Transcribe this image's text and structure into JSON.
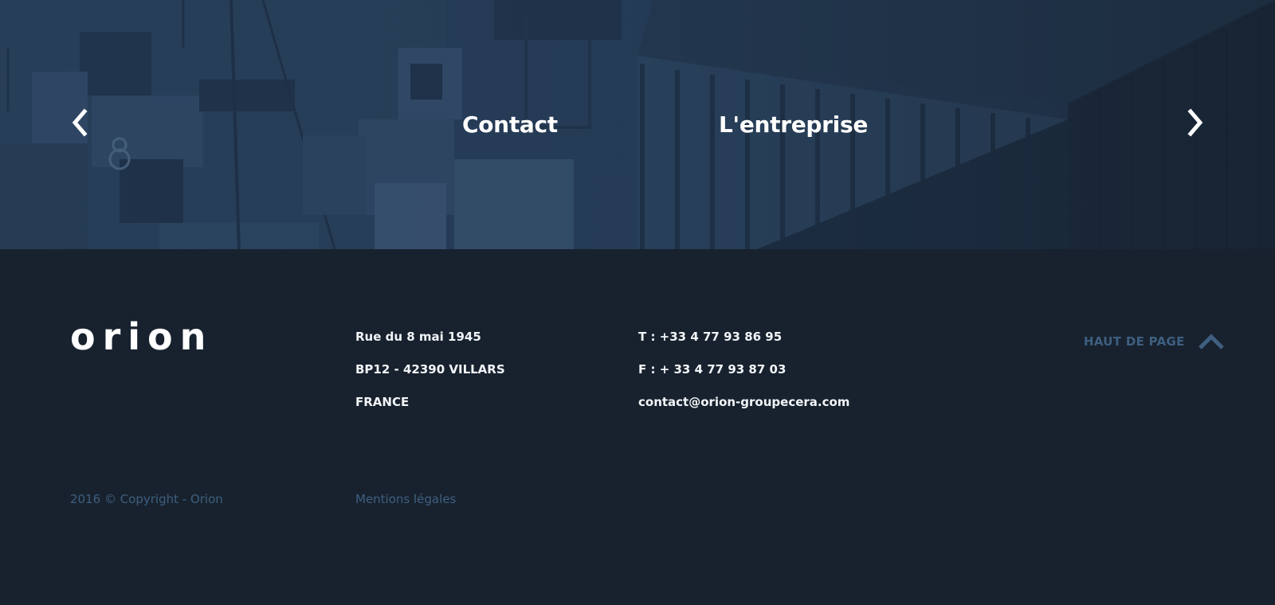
{
  "hero": {
    "prev_icon": "chevron-left-icon",
    "next_icon": "chevron-right-icon",
    "links": [
      {
        "label": "Contact"
      },
      {
        "label": "L'entreprise"
      }
    ]
  },
  "footer": {
    "logo": "orion",
    "address": {
      "line1": "Rue du 8 mai 1945",
      "line2": "BP12 - 42390 VILLARS",
      "line3": "FRANCE"
    },
    "contact": {
      "phone": "T : +33 4 77 93 86 95",
      "fax": "F : + 33 4 77 93 87 03",
      "email": "contact@orion-groupecera.com"
    },
    "back_to_top": {
      "label": "HAUT DE PAGE",
      "icon": "chevron-up-icon"
    },
    "copyright": "2016 © Copyright - Orion",
    "legal_link": "Mentions légales"
  },
  "colors": {
    "background": "#18222e",
    "hero_tint": "#22344a",
    "text_primary": "#ffffff",
    "text_muted": "#3e5f80"
  }
}
